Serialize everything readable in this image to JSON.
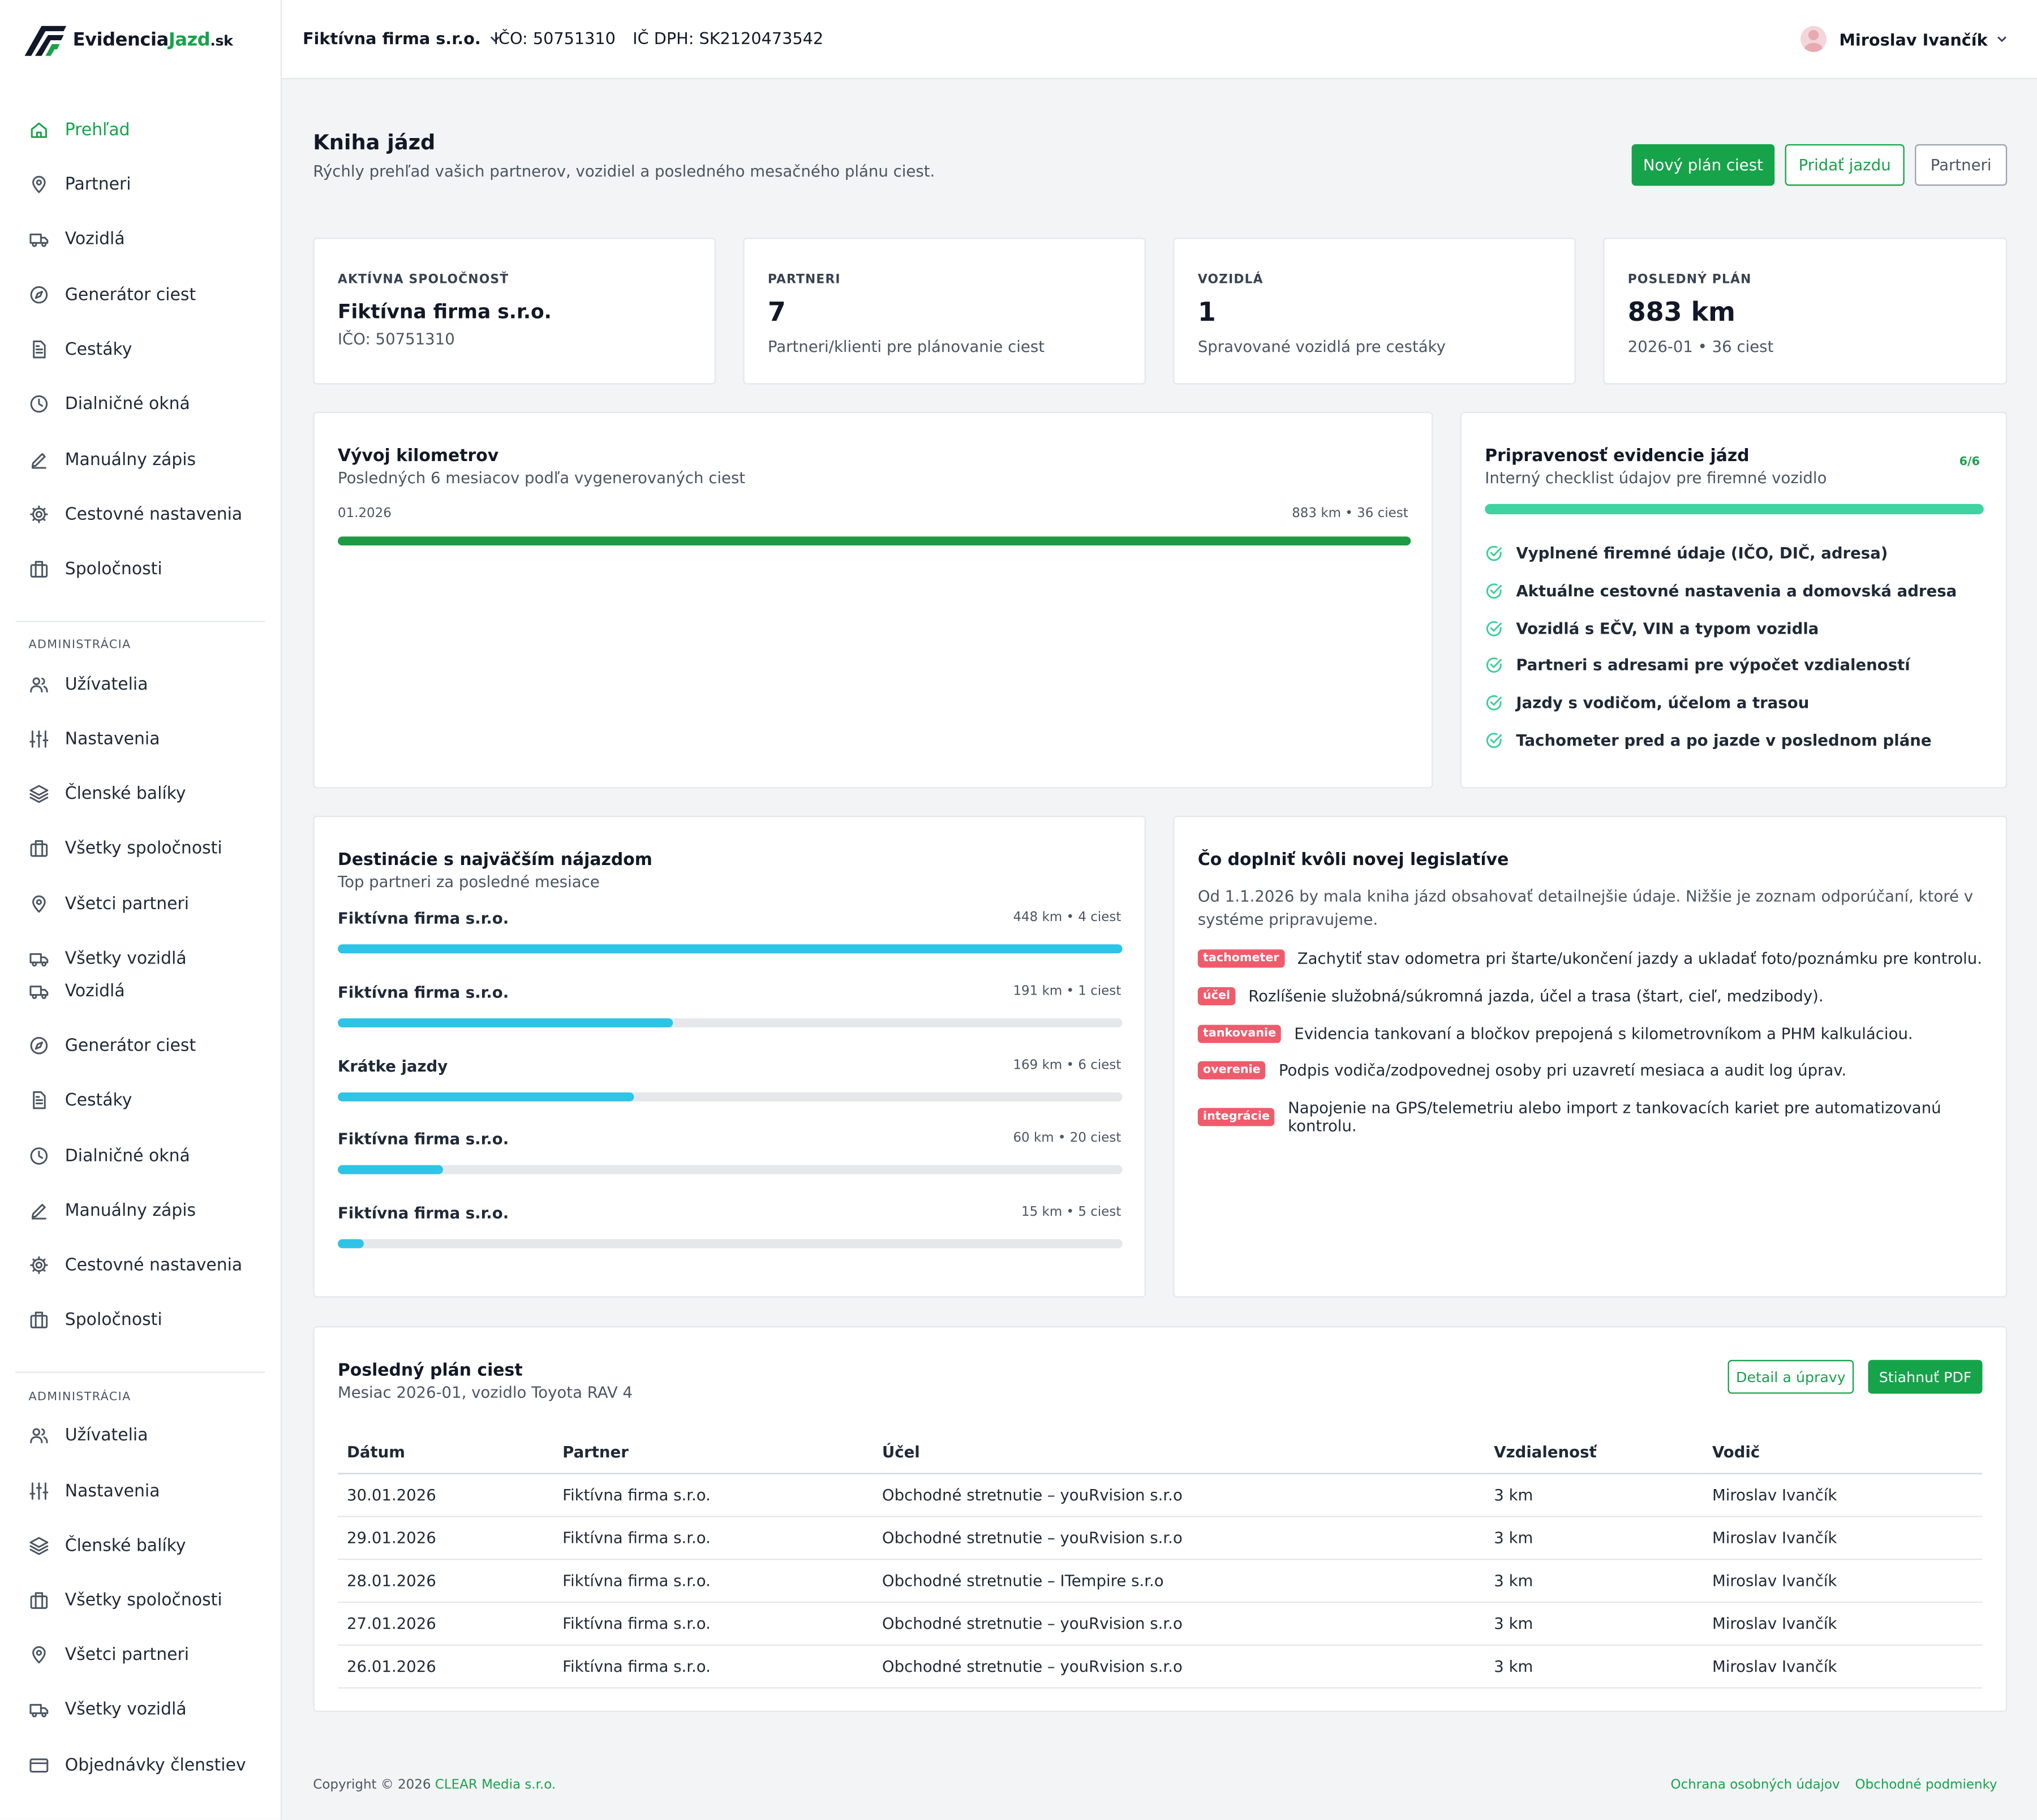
{
  "brand": {
    "name_dark": "Evidencia",
    "name_green": "Jazd",
    "tld": ".sk"
  },
  "nav": {
    "main": [
      {
        "label": "Prehľad",
        "icon": "home-icon",
        "active": true
      },
      {
        "label": "Partneri",
        "icon": "map-pin-icon"
      },
      {
        "label": "Vozidlá",
        "icon": "truck-icon"
      },
      {
        "label": "Generátor ciest",
        "icon": "compass-icon"
      },
      {
        "label": "Cestáky",
        "icon": "document-icon"
      },
      {
        "label": "Dialničné okná",
        "icon": "clock-icon"
      },
      {
        "label": "Manuálny zápis",
        "icon": "pen-icon"
      },
      {
        "label": "Cestovné nastavenia",
        "icon": "gear-icon"
      },
      {
        "label": "Spoločnosti",
        "icon": "building-icon"
      }
    ],
    "admin_heading": "ADMINISTRÁCIA",
    "admin": [
      {
        "label": "Užívatelia",
        "icon": "users-icon"
      },
      {
        "label": "Nastavenia",
        "icon": "sliders-icon"
      },
      {
        "label": "Členské balíky",
        "icon": "layers-icon"
      },
      {
        "label": "Všetky spoločnosti",
        "icon": "building-icon"
      },
      {
        "label": "Všetci partneri",
        "icon": "map-pin-icon"
      },
      {
        "label": "Všetky vozidlá",
        "icon": "truck-icon"
      }
    ],
    "main2": [
      {
        "label": "Vozidlá",
        "icon": "truck-icon"
      },
      {
        "label": "Generátor ciest",
        "icon": "compass-icon"
      },
      {
        "label": "Cestáky",
        "icon": "document-icon"
      },
      {
        "label": "Dialničné okná",
        "icon": "clock-icon"
      },
      {
        "label": "Manuálny zápis",
        "icon": "pen-icon"
      },
      {
        "label": "Cestovné nastavenia",
        "icon": "gear-icon"
      },
      {
        "label": "Spoločnosti",
        "icon": "building-icon"
      }
    ],
    "admin_heading2": "ADMINISTRÁCIA",
    "admin2": [
      {
        "label": "Užívatelia",
        "icon": "users-icon"
      },
      {
        "label": "Nastavenia",
        "icon": "sliders-icon"
      },
      {
        "label": "Členské balíky",
        "icon": "layers-icon"
      },
      {
        "label": "Všetky spoločnosti",
        "icon": "building-icon"
      },
      {
        "label": "Všetci partneri",
        "icon": "map-pin-icon"
      },
      {
        "label": "Všetky vozidlá",
        "icon": "truck-icon"
      },
      {
        "label": "Objednávky členstiev",
        "icon": "card-icon"
      }
    ]
  },
  "topbar": {
    "company": "Fiktívna firma s.r.o.",
    "ico": "IČO: 50751310",
    "dic": "IČ DPH: SK2120473542",
    "user": "Miroslav Ivančík"
  },
  "page": {
    "title": "Kniha jázd",
    "subtitle": "Rýchly prehľad vašich partnerov, vozidiel a posledného mesačného plánu ciest.",
    "btn_new_plan": "Nový plán ciest",
    "btn_add_trip": "Pridať jazdu",
    "btn_partners": "Partneri"
  },
  "stats": [
    {
      "label": "AKTÍVNA SPOLOČNOSŤ",
      "value": "Fiktívna firma s.r.o.",
      "note": "IČO: 50751310"
    },
    {
      "label": "PARTNERI",
      "value": "7",
      "note": "Partneri/klienti pre plánovanie ciest"
    },
    {
      "label": "VOZIDLÁ",
      "value": "1",
      "note": "Spravované vozidlá pre cestáky"
    },
    {
      "label": "POSLEDNÝ PLÁN",
      "value": "883 km",
      "note": "2026-01 • 36 ciest"
    }
  ],
  "km": {
    "title": "Vývoj kilometrov",
    "subtitle": "Posledných 6 mesiacov podľa vygenerovaných ciest",
    "month": "01.2026",
    "value": "883 km • 36 ciest",
    "fill": 1.0,
    "color": "#1e9b42"
  },
  "readiness": {
    "title": "Pripravenosť evidencie jázd",
    "subtitle": "Interný checklist údajov pre firemné vozidlo",
    "count": "6/6",
    "fill": 1.0,
    "color": "#3ed3a0",
    "items": [
      "Vyplnené firemné údaje (IČO, DIČ, adresa)",
      "Aktuálne cestovné nastavenia a domovská adresa",
      "Vozidlá s EČV, VIN a typom vozidla",
      "Partneri s adresami pre výpočet vzdialeností",
      "Jazdy s vodičom, účelom a trasou",
      "Tachometer pred a po jazde v poslednom pláne"
    ]
  },
  "destinations": {
    "title": "Destinácie s najväčším nájazdom",
    "subtitle": "Top partneri za posledné mesiace",
    "color": "#2ec4e6",
    "items": [
      {
        "name": "Fiktívna firma s.r.o.",
        "value": "448 km • 4 ciest",
        "km": 448
      },
      {
        "name": "Fiktívna firma s.r.o.",
        "value": "191 km • 1 ciest",
        "km": 191
      },
      {
        "name": "Krátke jazdy",
        "value": "169 km • 6 ciest",
        "km": 169
      },
      {
        "name": "Fiktívna firma s.r.o.",
        "value": "60 km • 20 ciest",
        "km": 60
      },
      {
        "name": "Fiktívna firma s.r.o.",
        "value": "15 km • 5 ciest",
        "km": 15
      }
    ]
  },
  "legislation": {
    "title": "Čo doplniť kvôli novej legislatíve",
    "text": "Od 1.1.2026 by mala kniha jázd obsahovať detailnejšie údaje. Nižšie je zoznam odporúčaní, ktoré v systéme pripravujeme.",
    "items": [
      {
        "tag": "tachometer",
        "text": "Zachytiť stav odometra pri štarte/ukončení jazdy a ukladať foto/poznámku pre kontrolu."
      },
      {
        "tag": "účel",
        "text": "Rozlíšenie služobná/súkromná jazda, účel a trasa (štart, cieľ, medzibody)."
      },
      {
        "tag": "tankovanie",
        "text": "Evidencia tankovaní a bločkov prepojená s kilometrovníkom a PHM kalkuláciou."
      },
      {
        "tag": "overenie",
        "text": "Podpis vodiča/zodpovednej osoby pri uzavretí mesiaca a audit log úprav."
      },
      {
        "tag": "integrácie",
        "text": "Napojenie na GPS/telemetriu alebo import z tankovacích kariet pre automatizovanú kontrolu."
      }
    ]
  },
  "last_plan": {
    "title": "Posledný plán ciest",
    "subtitle": "Mesiac 2026-01, vozidlo Toyota RAV 4",
    "btn_detail": "Detail a úpravy",
    "btn_pdf": "Stiahnuť PDF",
    "columns": [
      "Dátum",
      "Partner",
      "Účel",
      "Vzdialenosť",
      "Vodič"
    ],
    "rows": [
      [
        "30.01.2026",
        "Fiktívna firma s.r.o.",
        "Obchodné stretnutie – youRvision s.r.o",
        "3 km",
        "Miroslav Ivančík"
      ],
      [
        "29.01.2026",
        "Fiktívna firma s.r.o.",
        "Obchodné stretnutie – youRvision s.r.o",
        "3 km",
        "Miroslav Ivančík"
      ],
      [
        "28.01.2026",
        "Fiktívna firma s.r.o.",
        "Obchodné stretnutie – ITempire s.r.o",
        "3 km",
        "Miroslav Ivančík"
      ],
      [
        "27.01.2026",
        "Fiktívna firma s.r.o.",
        "Obchodné stretnutie – youRvision s.r.o",
        "3 km",
        "Miroslav Ivančík"
      ],
      [
        "26.01.2026",
        "Fiktívna firma s.r.o.",
        "Obchodné stretnutie – youRvision s.r.o",
        "3 km",
        "Miroslav Ivančík"
      ]
    ]
  },
  "footer": {
    "copyright": "Copyright © 2026",
    "company": "CLEAR Media s.r.o.",
    "privacy": "Ochrana osobných údajov",
    "terms": "Obchodné podmienky"
  }
}
